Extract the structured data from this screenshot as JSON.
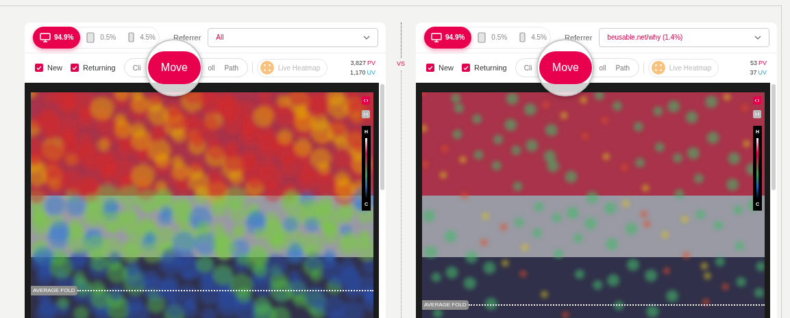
{
  "panels": [
    {
      "devices": [
        {
          "kind": "desktop",
          "label": "94.9%",
          "selected": true
        },
        {
          "kind": "tablet",
          "label": "0.5%",
          "selected": false
        },
        {
          "kind": "mobile",
          "label": "4.5%",
          "selected": false
        }
      ],
      "referrer": {
        "label": "Referrer",
        "value": "All"
      },
      "filters": [
        {
          "label": "New",
          "checked": true
        },
        {
          "label": "Returning",
          "checked": true
        }
      ],
      "modes": [
        {
          "label": "Cli",
          "selected": false
        },
        {
          "label": "Move",
          "selected": true
        },
        {
          "label": "oll",
          "selected": false
        },
        {
          "label": "Path",
          "selected": false
        }
      ],
      "live_heatmap": "Live Heatmap",
      "stats": [
        {
          "value": "3,827",
          "unit": "PV",
          "kind": "pv"
        },
        {
          "value": "1,170",
          "unit": "UV",
          "kind": "uv"
        }
      ],
      "legend": {
        "high": "H",
        "low": "C"
      },
      "fold_label": "AVERAGE FOLD"
    },
    {
      "devices": [
        {
          "kind": "desktop",
          "label": "94.9%",
          "selected": true
        },
        {
          "kind": "tablet",
          "label": "0.5%",
          "selected": false
        },
        {
          "kind": "mobile",
          "label": "4.5%",
          "selected": false
        }
      ],
      "referrer": {
        "label": "Referrer",
        "value": "beusable.net/why (1.4%)"
      },
      "filters": [
        {
          "label": "New",
          "checked": true
        },
        {
          "label": "Returning",
          "checked": true
        }
      ],
      "modes": [
        {
          "label": "Cli",
          "selected": false
        },
        {
          "label": "Move",
          "selected": true
        },
        {
          "label": "oll",
          "selected": false
        },
        {
          "label": "Path",
          "selected": false
        }
      ],
      "live_heatmap": "Live Heatmap",
      "stats": [
        {
          "value": "53",
          "unit": "PV",
          "kind": "pv"
        },
        {
          "value": "37",
          "unit": "UV",
          "kind": "uv"
        }
      ],
      "legend": {
        "high": "H",
        "low": "C"
      },
      "fold_label": "AVERAGE FOLD"
    }
  ],
  "separator": "VS"
}
